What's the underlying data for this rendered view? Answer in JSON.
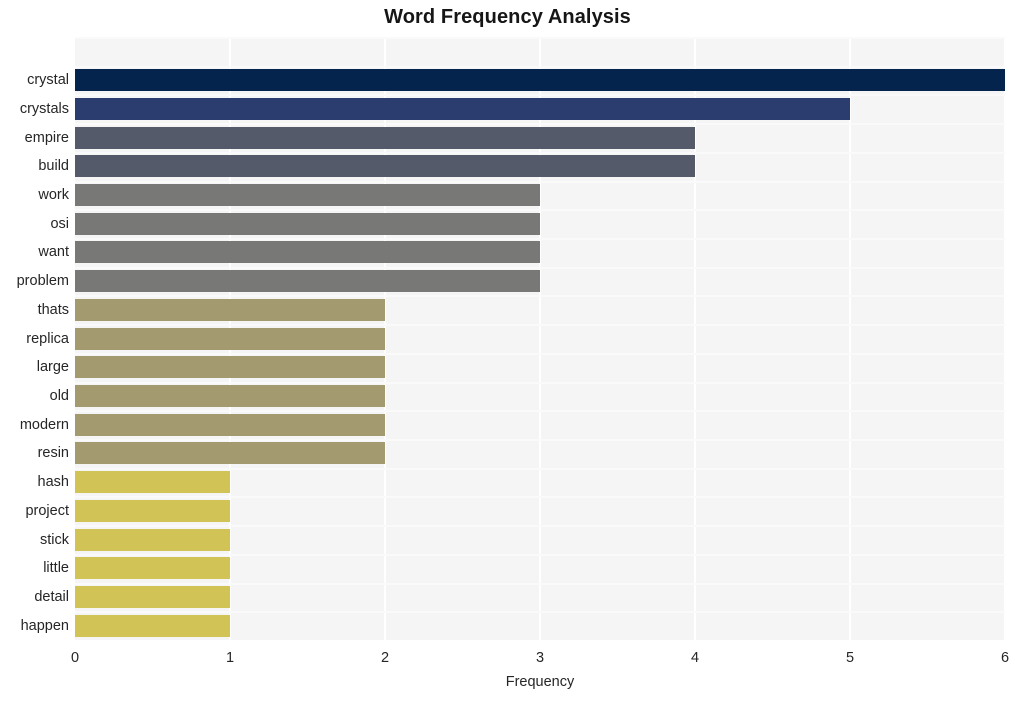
{
  "chart_data": {
    "type": "bar",
    "orientation": "horizontal",
    "title": "Word Frequency Analysis",
    "xlabel": "Frequency",
    "ylabel": "",
    "categories": [
      "crystal",
      "crystals",
      "empire",
      "build",
      "work",
      "osi",
      "want",
      "problem",
      "thats",
      "replica",
      "large",
      "old",
      "modern",
      "resin",
      "hash",
      "project",
      "stick",
      "little",
      "detail",
      "happen"
    ],
    "values": [
      6,
      5,
      4,
      4,
      3,
      3,
      3,
      3,
      2,
      2,
      2,
      2,
      2,
      2,
      1,
      1,
      1,
      1,
      1,
      1
    ],
    "bar_colors": [
      "#04234d",
      "#2b3c6e",
      "#555a6b",
      "#555a6b",
      "#787876",
      "#787876",
      "#787876",
      "#787876",
      "#a39a70",
      "#a39a70",
      "#a39a70",
      "#a39a70",
      "#a39a70",
      "#a39a70",
      "#d2c357",
      "#d2c357",
      "#d2c357",
      "#d2c357",
      "#d2c357",
      "#d2c357"
    ],
    "xlim": [
      0,
      6
    ],
    "xticks": [
      0,
      1,
      2,
      3,
      4,
      5,
      6
    ],
    "xtick_labels": [
      "0",
      "1",
      "2",
      "3",
      "4",
      "5",
      "6"
    ],
    "grid": true,
    "grid_color": "#ffffff",
    "plot_background": "#f5f5f5",
    "figure_background": "#ffffff",
    "title_color": "#161616",
    "tick_color": "#262626",
    "legend": null
  }
}
